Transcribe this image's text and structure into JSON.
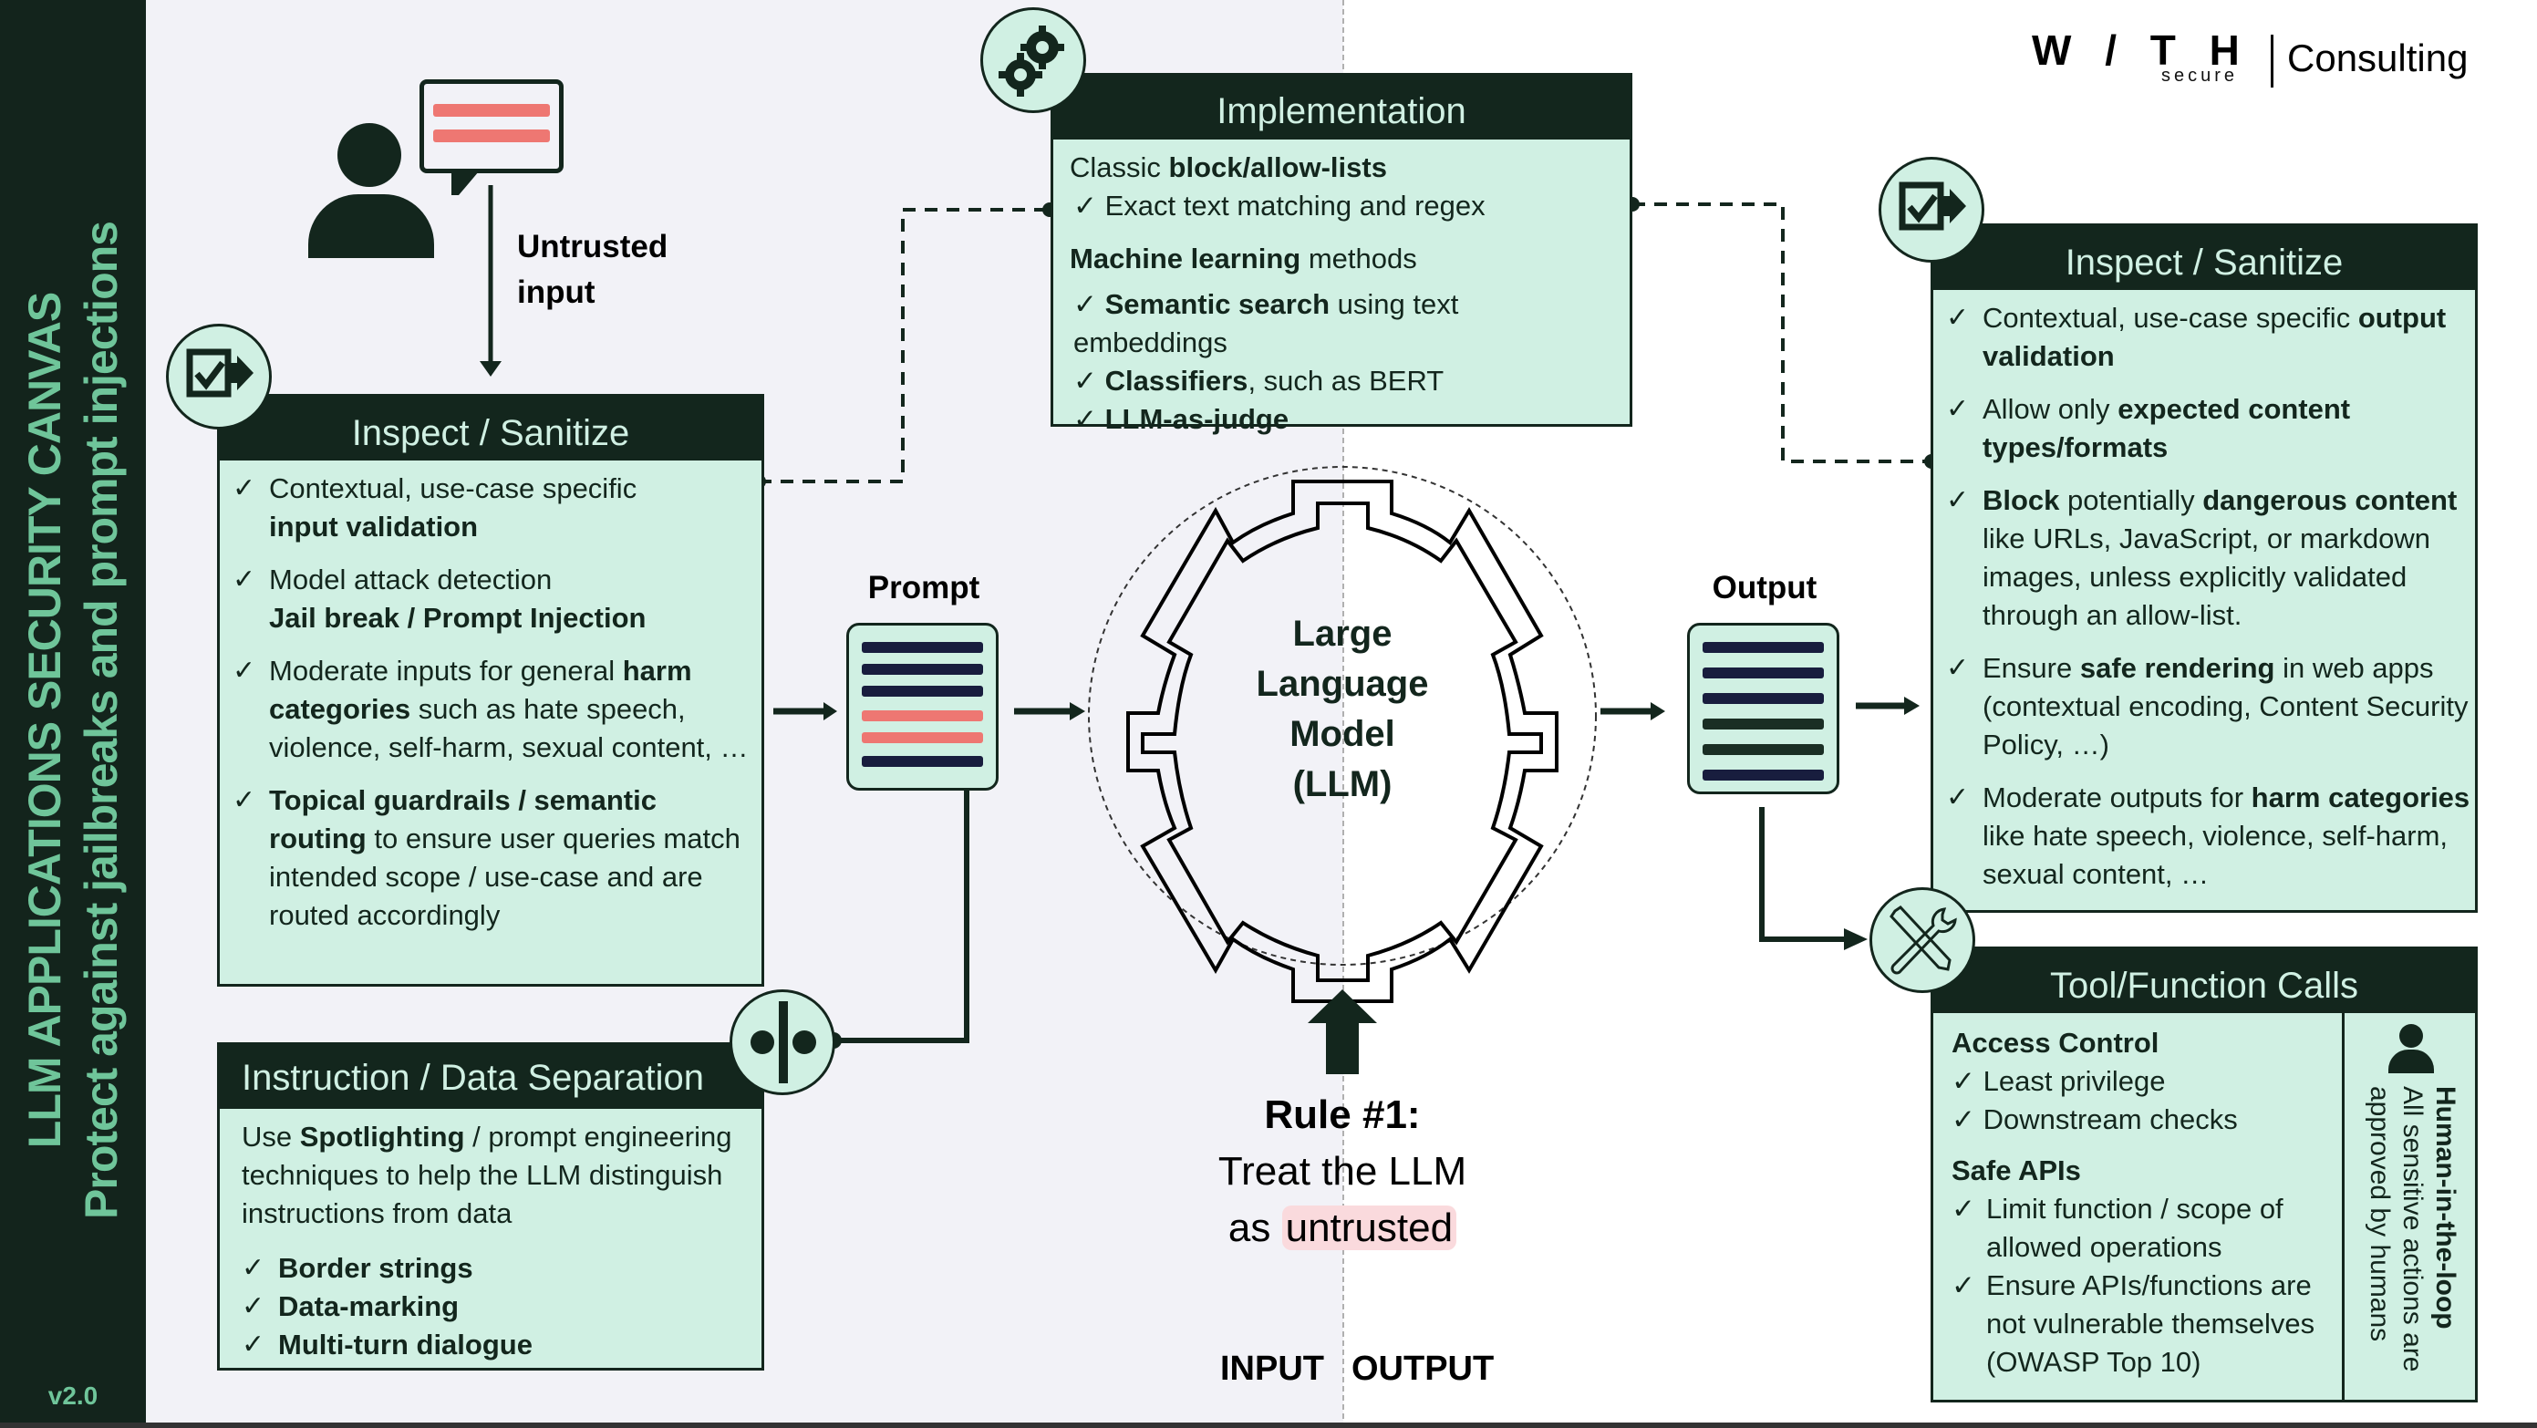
{
  "sidebar": {
    "title": "LLM APPLICATIONS SECURITY CANVAS",
    "subtitle": "Protect against jailbreaks and prompt injections",
    "version": "v2.0"
  },
  "logo": {
    "brand": "W / T H",
    "sub": "secure",
    "division": "Consulting"
  },
  "user": {
    "icon": "user-icon",
    "speech_icon": "speech-bubble-icon",
    "label_line1": "Untrusted",
    "label_line2": "input"
  },
  "input_inspect": {
    "icon": "checklist-arrow-icon",
    "title": "Inspect / Sanitize",
    "items": [
      {
        "pre": "Contextual, use-case specific",
        "bold": "input validation",
        "post": ""
      },
      {
        "pre": "Model attack detection",
        "bold": "Jail break / Prompt Injection",
        "post": ""
      },
      {
        "pre": "Moderate inputs for general ",
        "bold": "harm categories",
        "post": " such as hate speech, violence, self-harm, sexual content, …"
      },
      {
        "pre": "",
        "bold": "Topical guardrails / semantic routing",
        "post": " to ensure user queries match intended scope / use-case and are routed accordingly"
      }
    ]
  },
  "separation": {
    "icon": "separator-icon",
    "title": "Instruction / Data Separation",
    "intro_pre": "Use ",
    "intro_bold": "Spotlighting",
    "intro_post": " / prompt engineering techniques to help the LLM distinguish instructions from data",
    "items": [
      "Border strings",
      "Data-marking",
      "Multi-turn dialogue"
    ]
  },
  "implementation": {
    "icon": "gears-icon",
    "title": "Implementation",
    "classic_pre": "Classic ",
    "classic_bold": "block/allow-lists",
    "classic_items": [
      "Exact text matching and regex"
    ],
    "ml_bold": "Machine learning",
    "ml_post": " methods",
    "ml_items": [
      {
        "bold": "Semantic search",
        "post": " using text embeddings"
      },
      {
        "bold": "Classifiers",
        "post": ", such as BERT"
      },
      {
        "bold": "LLM-as-judge",
        "post": ""
      }
    ]
  },
  "prompt": {
    "label": "Prompt"
  },
  "llm": {
    "line1": "Large",
    "line2": "Language",
    "line3": "Model",
    "line4": "(LLM)"
  },
  "output": {
    "label": "Output"
  },
  "rule": {
    "title": "Rule #1:",
    "line2": "Treat the LLM",
    "line3_pre": "as ",
    "line3_hl": "untrusted"
  },
  "sides": {
    "input": "INPUT",
    "output": "OUTPUT"
  },
  "output_inspect": {
    "icon": "checklist-arrow-icon",
    "title": "Inspect / Sanitize",
    "items": [
      {
        "pre": "Contextual, use-case specific ",
        "bold": "output validation",
        "mid": "",
        "bold2": "",
        "post": ""
      },
      {
        "pre": "Allow only ",
        "bold": "expected content types/formats",
        "mid": "",
        "bold2": "",
        "post": ""
      },
      {
        "pre": "",
        "bold": "Block",
        "mid": " potentially ",
        "bold2": "dangerous content",
        "post": " like URLs, JavaScript, or markdown images, unless explicitly validated through an allow-list."
      },
      {
        "pre": "Ensure ",
        "bold": "safe rendering",
        "mid": " in web apps (contextual encoding, Content Security Policy, …)",
        "bold2": "",
        "post": ""
      },
      {
        "pre": "Moderate outputs for ",
        "bold": "harm categories",
        "mid": " like hate speech, violence, self-harm, sexual content, …",
        "bold2": "",
        "post": ""
      }
    ]
  },
  "tools": {
    "icon": "tools-icon",
    "title": "Tool/Function Calls",
    "access_title": "Access Control",
    "access_items": [
      "Least privilege",
      "Downstream checks"
    ],
    "apis_title": "Safe APIs",
    "apis_items": [
      "Limit function / scope of allowed operations",
      "Ensure APIs/functions are not vulnerable themselves (OWASP Top 10)"
    ],
    "hitl_icon": "person-icon",
    "hitl_title": "Human-in-the-loop",
    "hitl_text": "All sensitive actions are approved by humans"
  },
  "check_glyph": "✓",
  "colors": {
    "dark": "#13261d",
    "mint": "#d0f0e3",
    "accent_green": "#6fc59a",
    "danger_red": "#ee7772",
    "highlight_pink": "#fadadd",
    "input_bg": "#f2f2f7"
  }
}
